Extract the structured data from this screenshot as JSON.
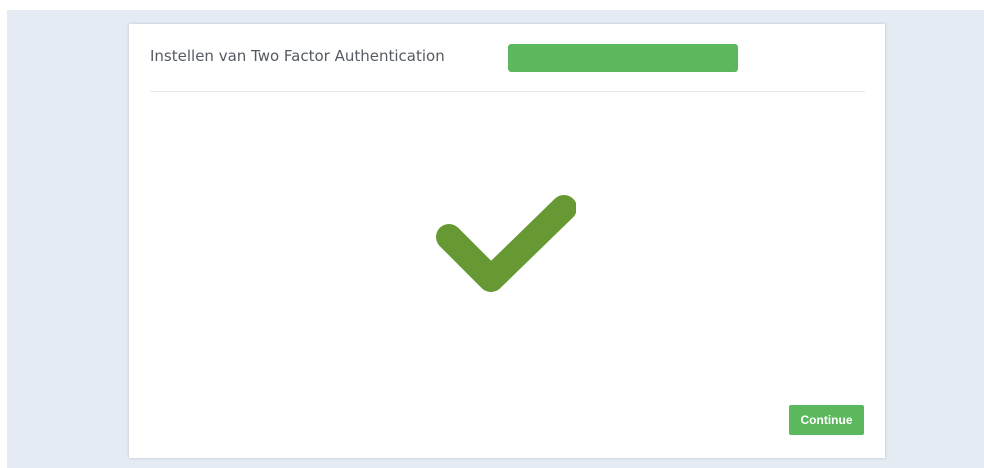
{
  "header": {
    "title": "Instellen van Two Factor Authentication"
  },
  "progress": {
    "percent": 100,
    "color": "#5cb85c"
  },
  "status": {
    "icon": "checkmark-icon",
    "color": "#669933"
  },
  "footer": {
    "continue_label": "Continue"
  },
  "colors": {
    "page_background": "#e4ebf3",
    "accent": "#5cb85c"
  }
}
